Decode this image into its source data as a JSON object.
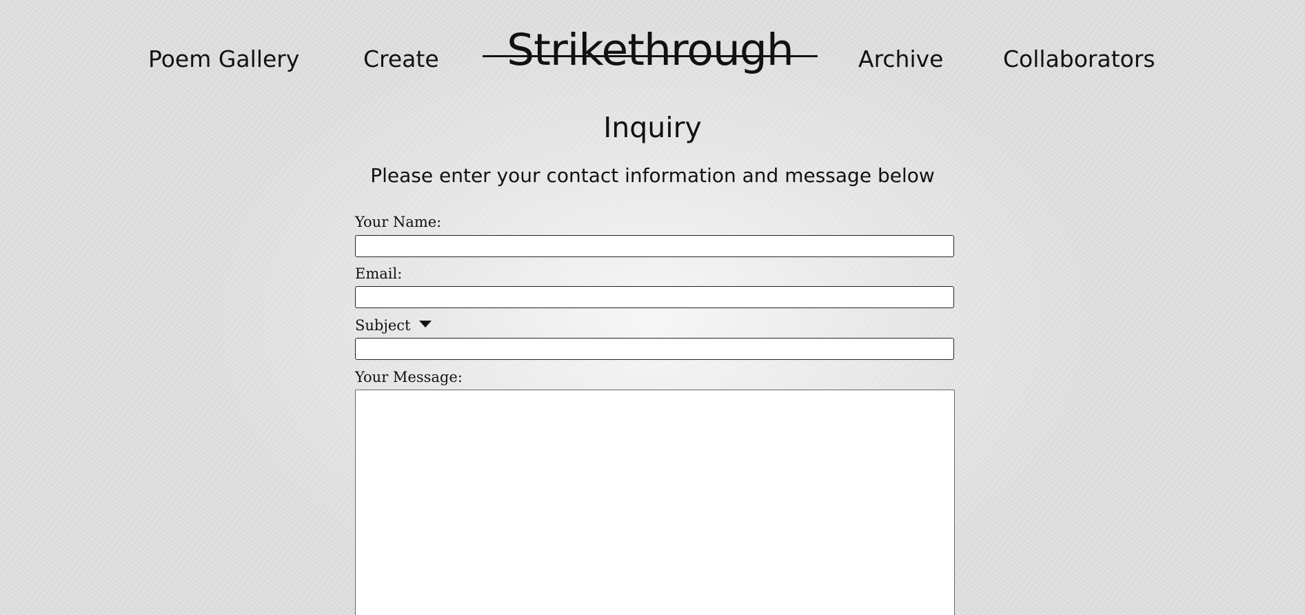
{
  "nav": {
    "left": [
      {
        "label": "Poem Gallery"
      },
      {
        "label": "Create"
      }
    ],
    "logo": "Strikethrough",
    "right": [
      {
        "label": "Archive"
      },
      {
        "label": "Collaborators"
      }
    ]
  },
  "page": {
    "title": "Inquiry",
    "subtitle": "Please enter your contact information and message below"
  },
  "form": {
    "name_label": "Your Name:",
    "name_value": "",
    "email_label": "Email:",
    "email_value": "",
    "subject_label": "Subject",
    "subject_icon": "caret-down-icon",
    "subject_value": "",
    "message_label": "Your Message:",
    "message_value": ""
  }
}
